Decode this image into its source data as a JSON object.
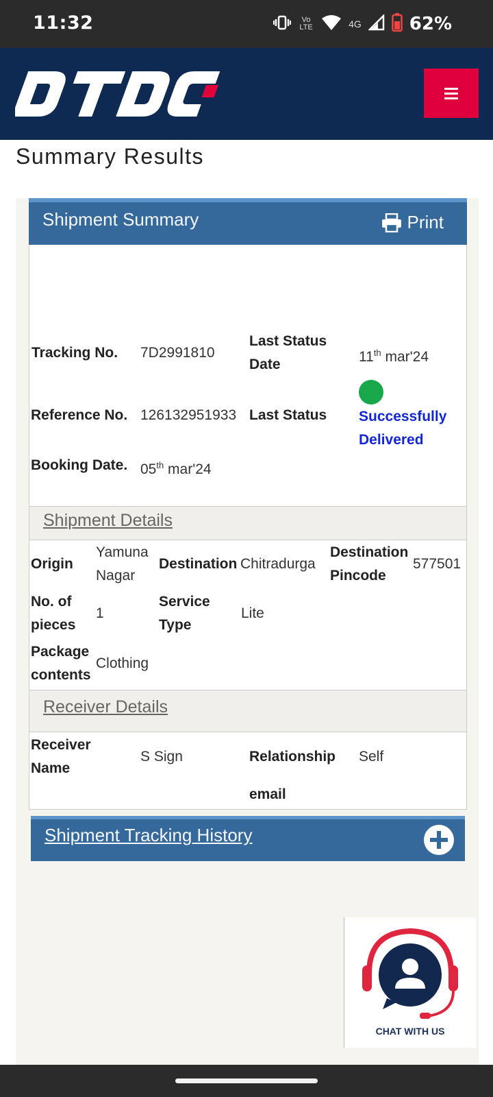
{
  "status_bar": {
    "time": "11:32",
    "network": "4G",
    "volte": "Vo LTE",
    "battery": "62%"
  },
  "header": {
    "logo_text": "DTDC",
    "menu_icon": "hamburger-icon",
    "brand_color": "#0e2a52",
    "accent_color": "#e0003c"
  },
  "page": {
    "title": "Summary Results"
  },
  "summary": {
    "heading": "Shipment Summary",
    "print_label": "Print",
    "tracking_label": "Tracking No.",
    "tracking_value": "7D2991810",
    "last_status_date_label": "Last Status Date",
    "last_status_date_day": "11",
    "last_status_date_sup": "th",
    "last_status_date_rest": " mar'24",
    "reference_label": "Reference No.",
    "reference_value": "126132951933",
    "last_status_label": "Last Status",
    "last_status_value": "Successfully Delivered",
    "status_color": "#18a849",
    "booking_label": "Booking Date.",
    "booking_day": "05",
    "booking_sup": "th",
    "booking_rest": " mar'24"
  },
  "shipment_details": {
    "heading": "Shipment Details",
    "origin_label": "Origin",
    "origin_value": "Yamuna Nagar",
    "destination_label": "Destination",
    "destination_value": "Chitradurga",
    "pincode_label": "Destination Pincode",
    "pincode_value": "577501",
    "pieces_label": "No. of pieces",
    "pieces_value": "1",
    "service_label": "Service Type",
    "service_value": "Lite",
    "contents_label": "Package contents",
    "contents_value": "Clothing"
  },
  "receiver_details": {
    "heading": "Receiver Details",
    "name_label": "Receiver Name",
    "name_value": "S Sign",
    "relationship_label": "Relationship",
    "relationship_value": "Self",
    "email_label": "email"
  },
  "tracking_history": {
    "heading": "Shipment Tracking History",
    "expand_icon": "plus-circle-icon"
  },
  "chat": {
    "label": "CHAT WITH US"
  }
}
